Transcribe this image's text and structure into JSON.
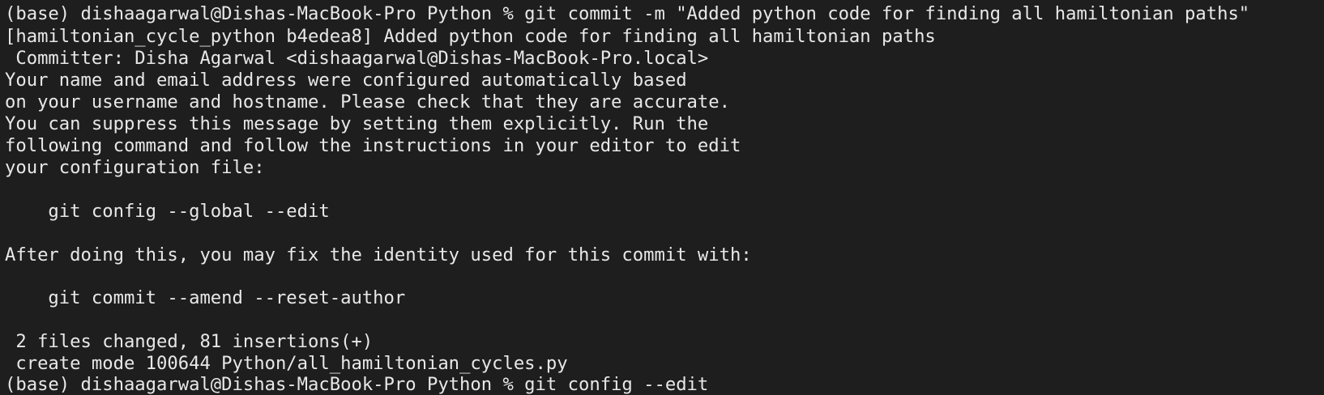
{
  "terminal": {
    "lines": [
      "(base) dishaagarwal@Dishas-MacBook-Pro Python % git commit -m \"Added python code for finding all hamiltonian paths\"",
      "[hamiltonian_cycle_python b4edea8] Added python code for finding all hamiltonian paths",
      " Committer: Disha Agarwal <dishaagarwal@Dishas-MacBook-Pro.local>",
      "Your name and email address were configured automatically based",
      "on your username and hostname. Please check that they are accurate.",
      "You can suppress this message by setting them explicitly. Run the",
      "following command and follow the instructions in your editor to edit",
      "your configuration file:",
      "",
      "    git config --global --edit",
      "",
      "After doing this, you may fix the identity used for this commit with:",
      "",
      "    git commit --amend --reset-author",
      "",
      " 2 files changed, 81 insertions(+)",
      " create mode 100644 Python/all_hamiltonian_cycles.py",
      "(base) dishaagarwal@Dishas-MacBook-Pro Python % git config --edit"
    ]
  },
  "colors": {
    "background": "#1e1e1e",
    "foreground": "#e8e8e8"
  }
}
